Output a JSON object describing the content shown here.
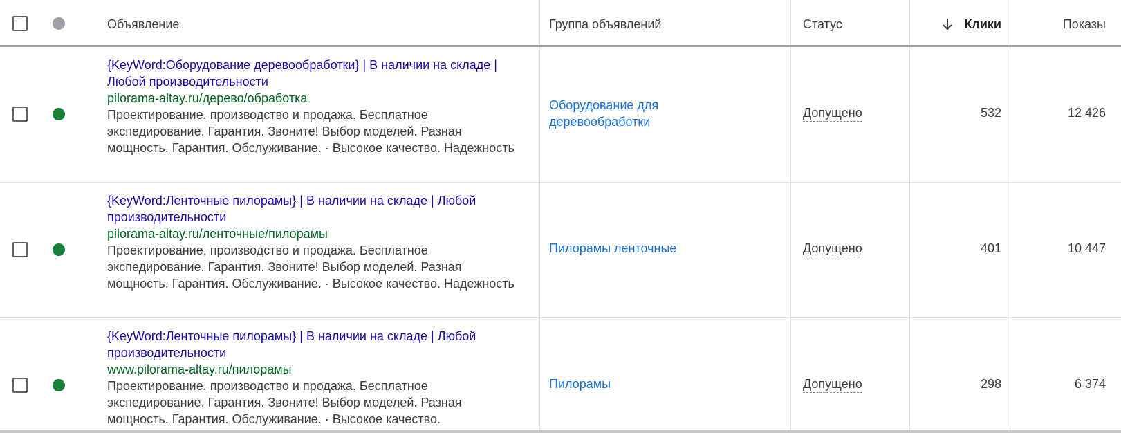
{
  "header": {
    "ad": "Объявление",
    "group": "Группа объявлений",
    "status": "Статус",
    "clicks": "Клики",
    "shows": "Показы"
  },
  "rows": [
    {
      "title": "{KeyWord:Оборудование деревообработки} | В наличии на складе | Любой производительности",
      "url": "pilorama-altay.ru/дерево/обработка",
      "desc": "Проектирование, производство и продажа. Бесплатное экспедирование. Гарантия. Звоните! Выбор моделей. Разная мощность. Гарантия. Обслуживание. · Высокое качество. Надежность",
      "group": "Оборудование для деревообработки",
      "status": "Допущено",
      "clicks": "532",
      "shows": "12 426"
    },
    {
      "title": "{KeyWord:Ленточные пилорамы} | В наличии на складе | Любой производительности",
      "url": "pilorama-altay.ru/ленточные/пилорамы",
      "desc": "Проектирование, производство и продажа. Бесплатное экспедирование. Гарантия. Звоните! Выбор моделей. Разная мощность. Гарантия. Обслуживание. · Высокое качество. Надежность",
      "group": "Пилорамы ленточные",
      "status": "Допущено",
      "clicks": "401",
      "shows": "10 447"
    },
    {
      "title": "{KeyWord:Ленточные пилорамы} | В наличии на складе | Любой производительности",
      "url": "www.pilorama-altay.ru/пилорамы",
      "desc": "Проектирование, производство и продажа. Бесплатное экспедирование. Гарантия. Звоните! Выбор моделей. Разная мощность. Гарантия. Обслуживание. · Высокое качество.",
      "group": "Пилорамы",
      "status": "Допущено",
      "clicks": "298",
      "shows": "6 374"
    }
  ],
  "colors": {
    "ad_title": "#1a0dab",
    "ad_url": "#006621",
    "group_link": "#1a73e8",
    "status_enabled": "#188038",
    "status_header": "#9aa0a6"
  },
  "icons": {
    "sort": "arrow-down-icon",
    "status": "status-dot-icon"
  }
}
